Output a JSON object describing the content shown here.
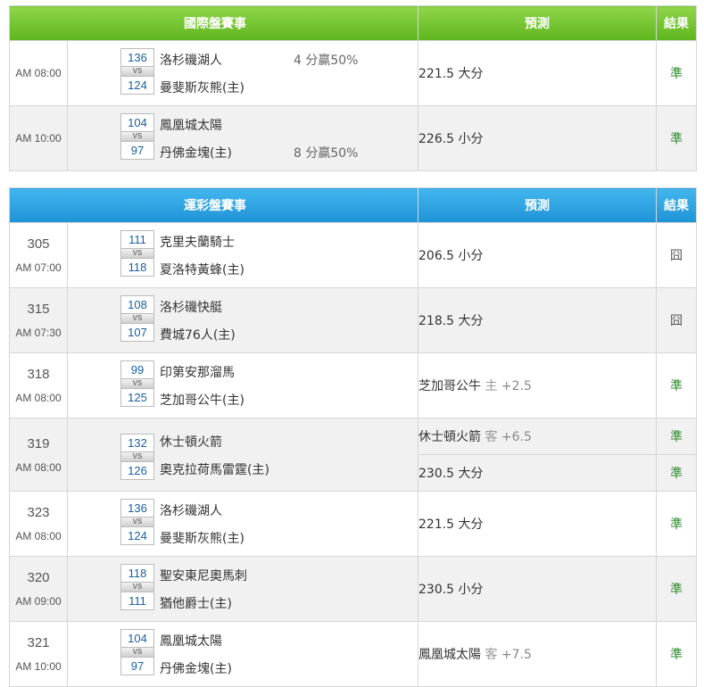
{
  "international": {
    "header": {
      "title": "國際盤賽事",
      "predict": "預測",
      "result": "結果"
    },
    "rows": [
      {
        "num": "",
        "time": "AM 08:00",
        "home_score": "136",
        "away_score": "124",
        "team_top": "洛杉磯湖人",
        "team_bot": "曼斐斯灰熊(主)",
        "bonus_top": "4 分贏50%",
        "bonus_bot": "",
        "predictions": [
          {
            "side": "",
            "line": "",
            "main": "221.5 大分",
            "result": "準"
          }
        ]
      },
      {
        "num": "",
        "time": "AM 10:00",
        "home_score": "104",
        "away_score": "97",
        "team_top": "鳳凰城太陽",
        "team_bot": "丹佛金塊(主)",
        "bonus_top": "",
        "bonus_bot": "8 分贏50%",
        "predictions": [
          {
            "side": "",
            "line": "",
            "main": "226.5 小分",
            "result": "準"
          }
        ]
      }
    ]
  },
  "lottery": {
    "header": {
      "title": "運彩盤賽事",
      "predict": "預測",
      "result": "結果"
    },
    "rows": [
      {
        "num": "305",
        "time": "AM 07:00",
        "home_score": "111",
        "away_score": "118",
        "team_top": "克里夫蘭騎士",
        "team_bot": "夏洛特黃蜂(主)",
        "predictions": [
          {
            "main": "206.5 小分",
            "side": "",
            "line": "",
            "result": "囧"
          }
        ]
      },
      {
        "num": "315",
        "time": "AM 07:30",
        "home_score": "108",
        "away_score": "107",
        "team_top": "洛杉磯快艇",
        "team_bot": "費城76人(主)",
        "predictions": [
          {
            "main": "218.5 大分",
            "side": "",
            "line": "",
            "result": "囧"
          }
        ]
      },
      {
        "num": "318",
        "time": "AM 08:00",
        "home_score": "99",
        "away_score": "125",
        "team_top": "印第安那溜馬",
        "team_bot": "芝加哥公牛(主)",
        "predictions": [
          {
            "main": "芝加哥公牛",
            "side": "主",
            "line": "+2.5",
            "result": "準"
          }
        ]
      },
      {
        "num": "319",
        "time": "AM 08:00",
        "home_score": "132",
        "away_score": "126",
        "team_top": "休士頓火箭",
        "team_bot": "奧克拉荷馬雷霆(主)",
        "predictions": [
          {
            "main": "休士頓火箭",
            "side": "客",
            "line": "+6.5",
            "result": "準"
          },
          {
            "main": "230.5 大分",
            "side": "",
            "line": "",
            "result": "準"
          }
        ]
      },
      {
        "num": "323",
        "time": "AM 08:00",
        "home_score": "136",
        "away_score": "124",
        "team_top": "洛杉磯湖人",
        "team_bot": "曼斐斯灰熊(主)",
        "predictions": [
          {
            "main": "221.5 大分",
            "side": "",
            "line": "",
            "result": "準"
          }
        ]
      },
      {
        "num": "320",
        "time": "AM 09:00",
        "home_score": "118",
        "away_score": "111",
        "team_top": "聖安東尼奧馬刺",
        "team_bot": "猶他爵士(主)",
        "predictions": [
          {
            "main": "230.5 小分",
            "side": "",
            "line": "",
            "result": "準"
          }
        ]
      },
      {
        "num": "321",
        "time": "AM 10:00",
        "home_score": "104",
        "away_score": "97",
        "team_top": "鳳凰城太陽",
        "team_bot": "丹佛金塊(主)",
        "predictions": [
          {
            "main": "鳳凰城太陽",
            "side": "客",
            "line": "+7.5",
            "result": "準"
          }
        ]
      }
    ]
  },
  "vs_label": "VS",
  "colors": {
    "intl_header": "#6cc12a",
    "lottery_header": "#2ba3e3",
    "win": "#2e8b2e",
    "score": "#1a5fa0"
  }
}
